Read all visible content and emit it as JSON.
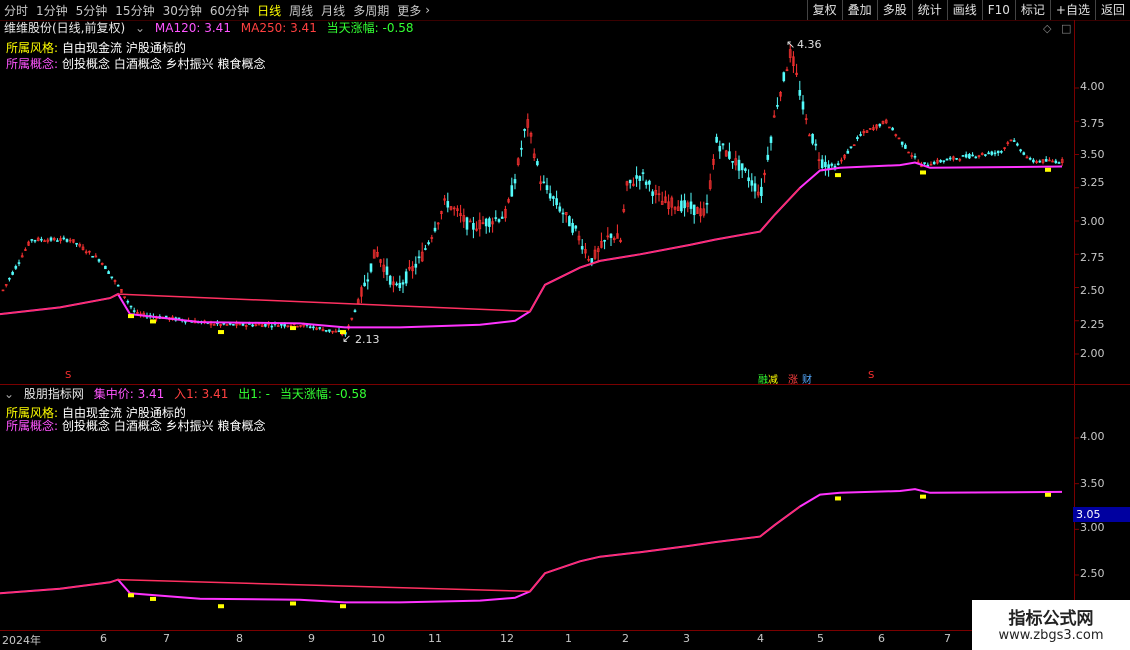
{
  "toolbar": {
    "timeframes": [
      "分时",
      "1分钟",
      "5分钟",
      "15分钟",
      "30分钟",
      "60分钟",
      "日线",
      "周线",
      "月线",
      "多周期",
      "更多"
    ],
    "active": "日线",
    "right": [
      "复权",
      "叠加",
      "多股",
      "统计",
      "画线",
      "F10",
      "标记",
      "+自选",
      "返回"
    ]
  },
  "upper": {
    "name": "维维股份(日线,前复权)",
    "ma120": "MA120: 3.41",
    "ma250": "MA250: 3.41",
    "change": "当天涨幅: -0.58",
    "style_label": "所属风格:",
    "style_value": "自由现金流 沪股通标的",
    "concept_label": "所属概念:",
    "concept_value": "创投概念 白酒概念 乡村振兴 粮食概念",
    "axis": [
      "4.00",
      "3.75",
      "3.50",
      "3.25",
      "3.00",
      "2.75",
      "2.50",
      "2.25",
      "2.00"
    ],
    "high_label": "4.36",
    "low_label": "2.13",
    "signal": "S",
    "badges": [
      "融",
      "减",
      "涨",
      "财"
    ]
  },
  "lower": {
    "name": "股朋指标网",
    "center": "集中价: 3.41",
    "entry": "入1: 3.41",
    "exit": "出1: -",
    "change": "当天涨幅: -0.58",
    "style_label": "所属风格:",
    "style_value": "自由现金流 沪股通标的",
    "concept_label": "所属概念:",
    "concept_value": "创投概念 白酒概念 乡村振兴 粮食概念",
    "axis": [
      "4.00",
      "3.50",
      "3.00",
      "2.50"
    ],
    "cursor_price": "3.05"
  },
  "xaxis": [
    "2024年",
    "6",
    "7",
    "8",
    "9",
    "10",
    "11",
    "12",
    "1",
    "2",
    "3",
    "4",
    "5",
    "6",
    "7"
  ],
  "watermark": {
    "title": "指标公式网",
    "url": "www.zbgs3.com"
  },
  "colors": {
    "up": "#ff3232",
    "down": "#54fcfc",
    "ma": "#ff33ff",
    "grid": "#3a0000"
  }
}
